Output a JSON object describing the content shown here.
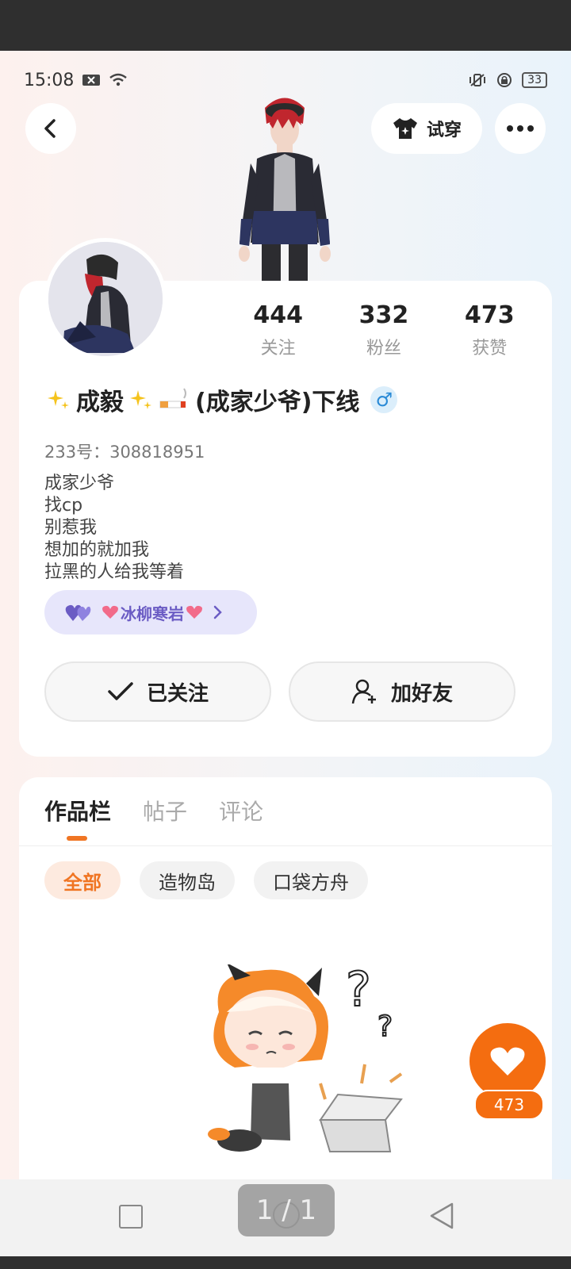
{
  "status": {
    "time": "15:08",
    "battery": "33"
  },
  "header": {
    "try_on_label": "试穿"
  },
  "profile": {
    "stats": [
      {
        "num": "444",
        "label": "关注"
      },
      {
        "num": "332",
        "label": "粉丝"
      },
      {
        "num": "473",
        "label": "获赞"
      }
    ],
    "name_text": "成毅",
    "name_suffix": "(成家少爷)下线",
    "gender_symbol": "♂",
    "uid": "233号：308818951",
    "bio": [
      "成家少爷",
      "找cp",
      "别惹我",
      "想加的就加我",
      "拉黑的人给我等着"
    ],
    "cp_name": "冰柳寒岩",
    "follow_button": "已关注",
    "add_friend_button": "加好友"
  },
  "tabs": {
    "items": [
      "作品栏",
      "帖子",
      "评论"
    ]
  },
  "chips": {
    "items": [
      "全部",
      "造物岛",
      "口袋方舟"
    ]
  },
  "like": {
    "count": "473"
  },
  "pager": {
    "label": "1 / 1"
  },
  "colors": {
    "accent": "#f46d10",
    "cp_bg": "#e7e6fb"
  }
}
